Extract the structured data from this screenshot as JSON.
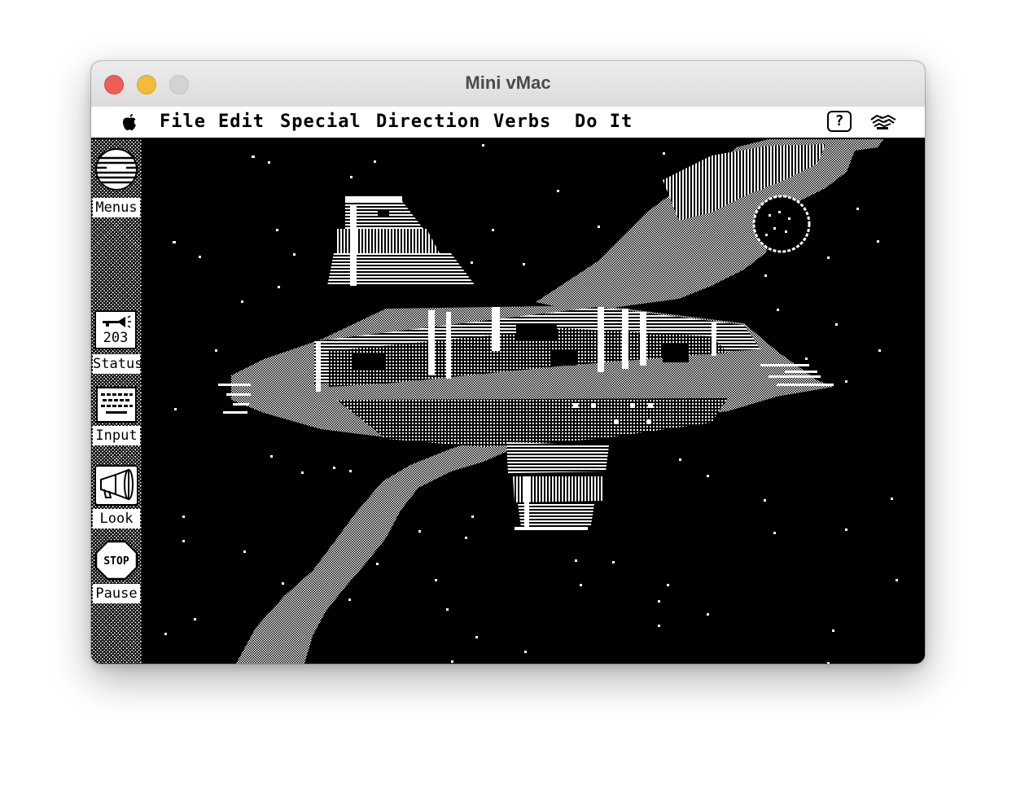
{
  "window": {
    "title": "Mini vMac"
  },
  "menubar": {
    "apple_icon": "apple-icon",
    "items": [
      {
        "label": "File"
      },
      {
        "label": "Edit"
      },
      {
        "label": "Special"
      },
      {
        "label": "Direction"
      },
      {
        "label": "Verbs"
      },
      {
        "label": "Do It"
      }
    ],
    "help_label": "?"
  },
  "sidebar": {
    "menus": {
      "label": "Menus",
      "icon": "menus-globe-icon"
    },
    "status": {
      "label": "Status",
      "value": "203",
      "icon": "status-trumpet-icon"
    },
    "input": {
      "label": "Input",
      "icon": "keyboard-icon"
    },
    "look": {
      "label": "Look",
      "icon": "megaphone-icon"
    },
    "pause": {
      "label": "Pause",
      "sign": "STOP",
      "icon": "stop-sign-icon"
    }
  },
  "colors": {
    "screen": "#000000",
    "dither": "#ffffff",
    "close": "#ec5f56",
    "minimize": "#f3bb3b",
    "zoom": "#d3d3d3"
  }
}
